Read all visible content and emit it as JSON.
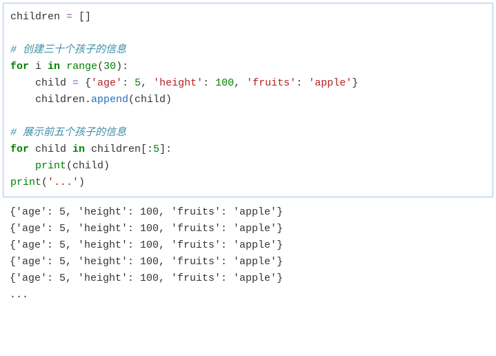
{
  "code": {
    "l1_var": "children ",
    "l1_eq": "= ",
    "l1_br": "[]",
    "l3_cmt": "# 创建三十个孩子的信息",
    "l4_for": "for",
    "l4_i": " i ",
    "l4_in": "in",
    "l4_sp": " ",
    "l4_range": "range",
    "l4_lp": "(",
    "l4_30": "30",
    "l4_rp": "):",
    "l5_indent": "    child ",
    "l5_eq": "= ",
    "l5_lb": "{",
    "l5_k1": "'age'",
    "l5_c1": ": ",
    "l5_v1": "5",
    "l5_cm1": ", ",
    "l5_k2": "'height'",
    "l5_c2": ": ",
    "l5_v2": "100",
    "l5_cm2": ", ",
    "l5_k3": "'fruits'",
    "l5_c3": ": ",
    "l5_v3": "'apple'",
    "l5_rb": "}",
    "l6_indent": "    children.",
    "l6_append": "append",
    "l6_lp": "(child)",
    "l8_cmt": "# 展示前五个孩子的信息",
    "l9_for": "for",
    "l9_child": " child ",
    "l9_in": "in",
    "l9_rest": " children[:",
    "l9_5": "5",
    "l9_rb": "]:",
    "l10_indent": "    ",
    "l10_print": "print",
    "l10_arg": "(child)",
    "l11_print": "print",
    "l11_lp": "(",
    "l11_str": "'...'",
    "l11_rp": ")"
  },
  "output": {
    "line1": "{'age': 5, 'height': 100, 'fruits': 'apple'}",
    "line2": "{'age': 5, 'height': 100, 'fruits': 'apple'}",
    "line3": "{'age': 5, 'height': 100, 'fruits': 'apple'}",
    "line4": "{'age': 5, 'height': 100, 'fruits': 'apple'}",
    "line5": "{'age': 5, 'height': 100, 'fruits': 'apple'}",
    "line6": "..."
  }
}
